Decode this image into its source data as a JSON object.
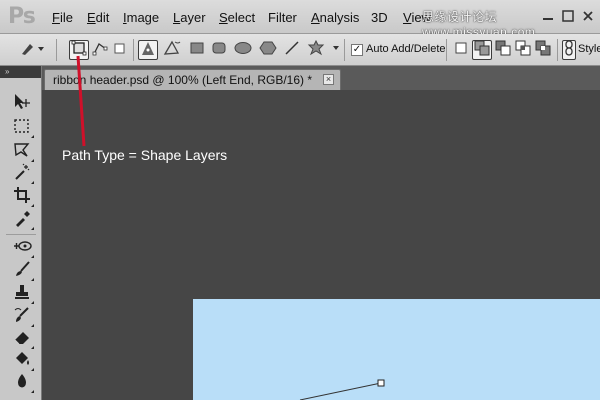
{
  "app": {
    "logo": "Ps"
  },
  "menu": {
    "items": [
      {
        "label": "File",
        "mnemonic": "F",
        "rest": "ile"
      },
      {
        "label": "Edit",
        "mnemonic": "E",
        "rest": "dit"
      },
      {
        "label": "Image",
        "mnemonic": "I",
        "rest": "mage"
      },
      {
        "label": "Layer",
        "mnemonic": "L",
        "rest": "ayer"
      },
      {
        "label": "Select",
        "mnemonic": "S",
        "rest": "elect"
      },
      {
        "label": "Filter",
        "mnemonic": "T",
        "rest": "Filter"
      },
      {
        "label": "Analysis",
        "mnemonic": "A",
        "rest": "nalysis"
      },
      {
        "label": "3D",
        "mnemonic": "D",
        "rest": "3D"
      },
      {
        "label": "View",
        "mnemonic": "V",
        "rest": "iew"
      }
    ],
    "watermark": "思缘设计论坛 www.missyuan.com"
  },
  "options_bar": {
    "auto_add_delete": {
      "label": "Auto Add/Delete",
      "checked": true
    },
    "style_label": "Style",
    "path_type_selected": "shape-layers"
  },
  "document": {
    "tab_title": "ribbon header.psd @ 100% (Left End, RGB/16) *",
    "close_glyph": "×"
  },
  "annotation": {
    "text": "Path Type = Shape Layers",
    "line_color": "#d0102a"
  },
  "colors": {
    "workspace": "#464646",
    "canvas": "#b9def8",
    "accent_red": "#d0102a"
  },
  "toolbox": {
    "tools": [
      "move-icon",
      "rectangular-marquee-icon",
      "lasso-icon",
      "magic-wand-icon",
      "crop-icon",
      "eyedropper-icon",
      "spot-healing-icon",
      "brush-icon",
      "clone-stamp-icon",
      "history-brush-icon",
      "eraser-icon",
      "paint-bucket-icon",
      "blur-icon"
    ]
  }
}
